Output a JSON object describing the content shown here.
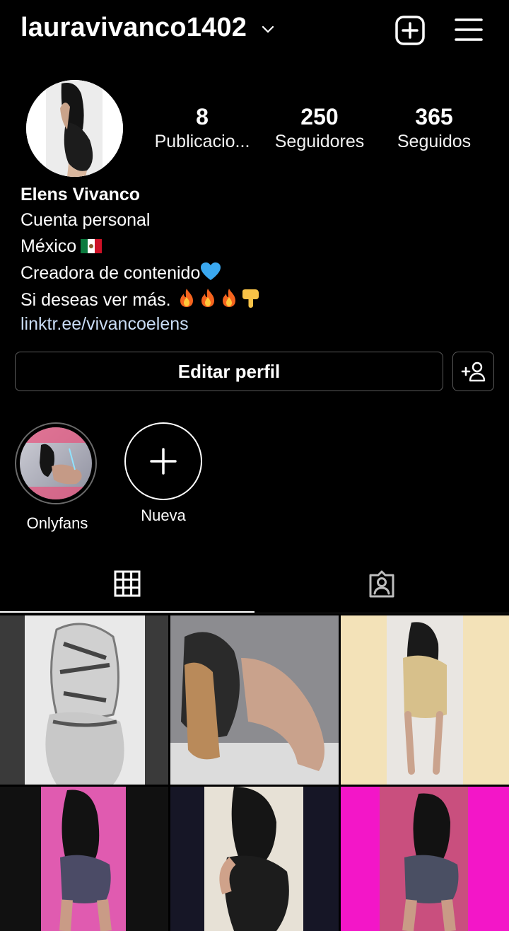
{
  "header": {
    "username": "lauravivanco1402",
    "chevron_icon": "chevron-down-icon",
    "new_post_icon": "plus-square-icon",
    "menu_icon": "hamburger-menu-icon"
  },
  "profile": {
    "stats": [
      {
        "value": "8",
        "label": "Publicacio..."
      },
      {
        "value": "250",
        "label": "Seguidores"
      },
      {
        "value": "365",
        "label": "Seguidos"
      }
    ],
    "name": "Elens Vivanco",
    "category": "Cuenta personal",
    "bio_lines": {
      "location": "México",
      "line2": "Creadora de contenido",
      "line3": "Si deseas ver más."
    },
    "link": "linktr.ee/vivancoelens"
  },
  "actions": {
    "edit_profile": "Editar perfil",
    "suggest_icon": "add-person-icon"
  },
  "highlights": [
    {
      "label": "Onlyfans"
    },
    {
      "label": "Nueva"
    }
  ],
  "tabs": {
    "grid_icon": "grid-icon",
    "tagged_icon": "tagged-person-icon",
    "active": "grid"
  },
  "colors": {
    "background": "#000000",
    "text": "#ffffff",
    "link": "#c9dcf5",
    "border": "#5b5b5b"
  }
}
